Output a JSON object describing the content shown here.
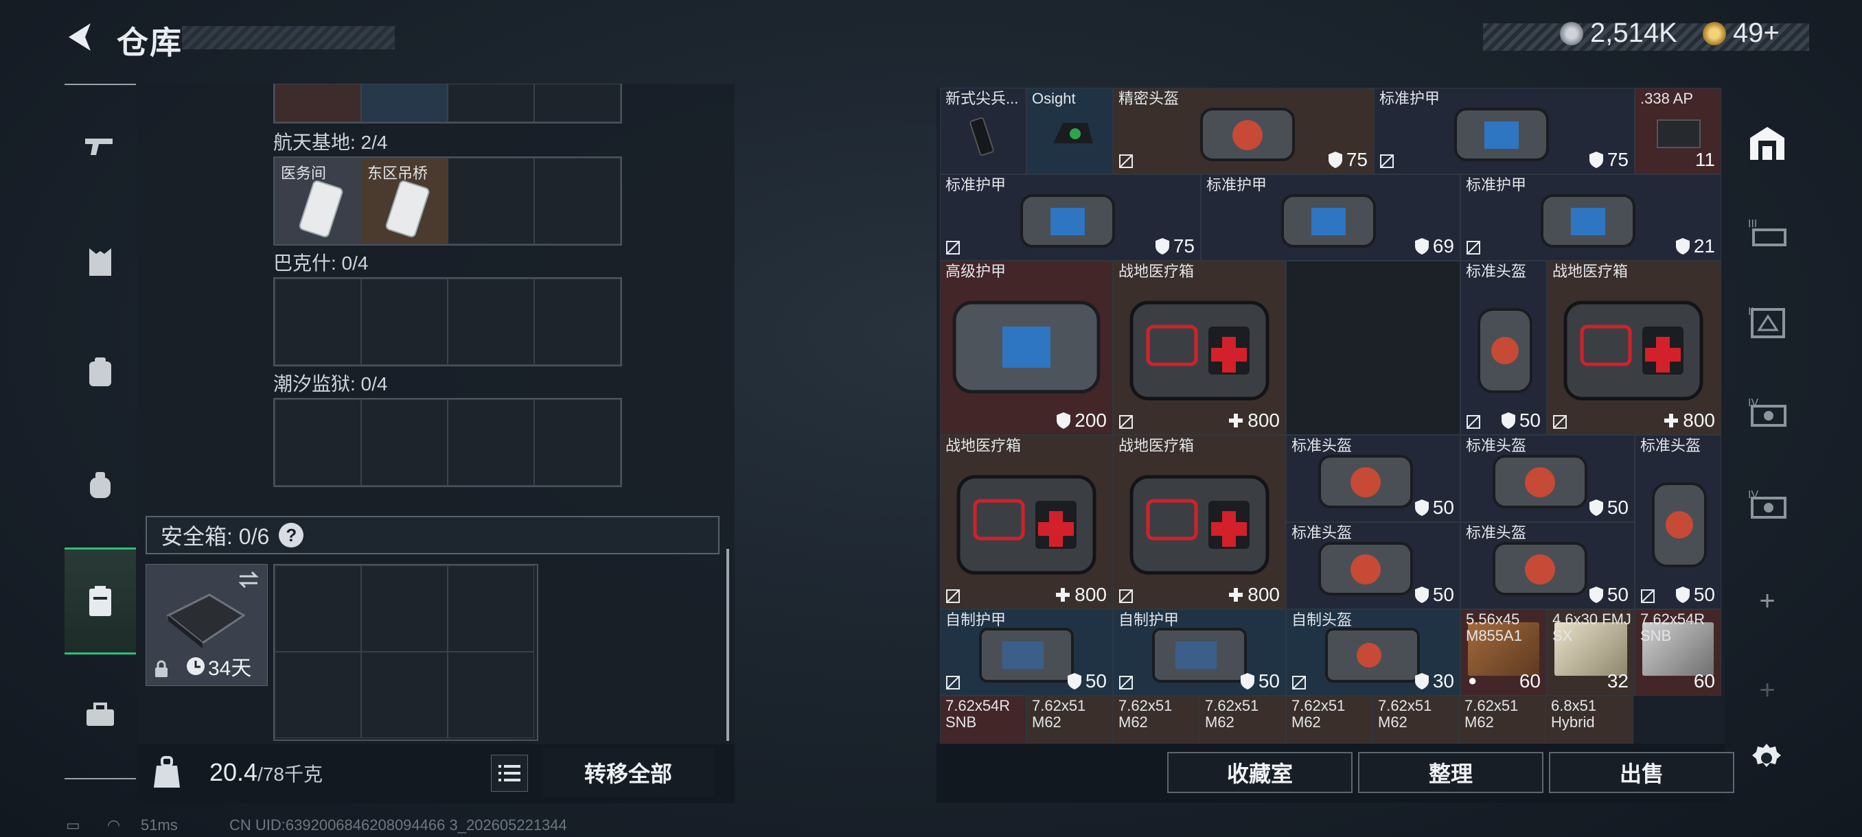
{
  "header": {
    "title": "仓库"
  },
  "currency": {
    "money": "2,514K",
    "tokens": "49+"
  },
  "safebox": {
    "sections": [
      {
        "label": "航天基地: 2/4",
        "items": [
          "医务间",
          "东区吊桥"
        ]
      },
      {
        "label": "巴克什: 0/4"
      },
      {
        "label": "潮汐监狱: 0/4"
      }
    ],
    "safe_label": "安全箱: 0/6",
    "help": "?",
    "case_days": "34天"
  },
  "footer": {
    "weight": "20.4",
    "weight_unit": "/78千克",
    "transfer_label": "转移全部"
  },
  "status": {
    "ping": "51ms",
    "uid": "CN UID:6392006846208094466 3_202605221344"
  },
  "inventory": {
    "items": [
      {
        "name": "新式尖兵..."
      },
      {
        "name": "Osight"
      },
      {
        "name": "精密头盔",
        "value": "75"
      },
      {
        "name": "标准护甲",
        "value": "75"
      },
      {
        "name": ".338 AP",
        "value": "11"
      },
      {
        "name": "标准护甲",
        "value": "75"
      },
      {
        "name": "标准护甲",
        "value": "69"
      },
      {
        "name": "标准护甲",
        "value": "21"
      },
      {
        "name": "高级护甲",
        "value": "200"
      },
      {
        "name": "战地医疗箱",
        "value": "800"
      },
      {
        "name": "标准头盔",
        "value": "50"
      },
      {
        "name": "战地医疗箱",
        "value": "800"
      },
      {
        "name": "战地医疗箱",
        "value": "800"
      },
      {
        "name": "战地医疗箱",
        "value": "800"
      },
      {
        "name": "标准头盔",
        "value": "50"
      },
      {
        "name": "标准头盔",
        "value": "50"
      },
      {
        "name": "标准头盔",
        "value": "50"
      },
      {
        "name": "标准头盔",
        "value": "50"
      },
      {
        "name": "标准头盔",
        "value": "50"
      },
      {
        "name": "自制护甲",
        "value": "50"
      },
      {
        "name": "自制护甲",
        "value": "50"
      },
      {
        "name": "自制头盔",
        "value": "30"
      },
      {
        "name": "5.56x45 M855A1",
        "value": "60"
      },
      {
        "name": "4.6x30 FMJ SX",
        "value": "32"
      },
      {
        "name": "7.62x54R SNB",
        "value": "60"
      },
      {
        "name": "7.62x54R SNB"
      },
      {
        "name": "7.62x51 M62"
      },
      {
        "name": "7.62x51 M62"
      },
      {
        "name": "7.62x51 M62"
      },
      {
        "name": "7.62x51 M62"
      },
      {
        "name": "7.62x51 M62"
      },
      {
        "name": "7.62x51 M62"
      },
      {
        "name": "6.8x51 Hybrid"
      }
    ]
  },
  "buttons": {
    "collection": "收藏室",
    "sort": "整理",
    "sell": "出售"
  }
}
